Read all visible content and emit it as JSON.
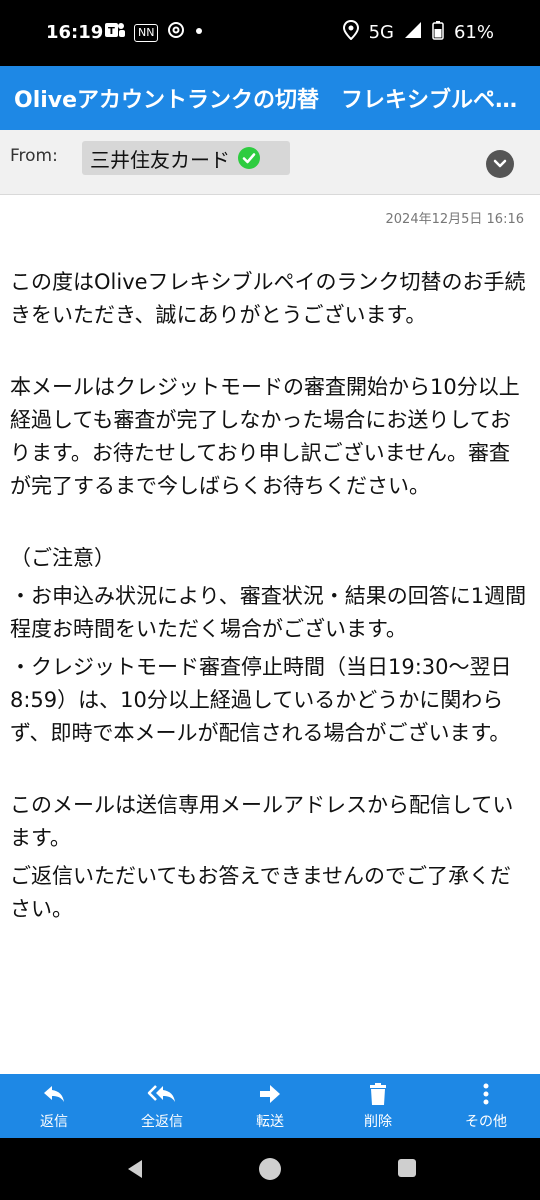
{
  "status_bar": {
    "time": "16:19",
    "app_icons": [
      "teams-icon",
      "nn-icon",
      "threads-icon",
      "dot-icon"
    ],
    "nn_label": "NN",
    "network": "5G",
    "battery": "61%"
  },
  "header": {
    "title": "Oliveアカウントランクの切替　フレキシブルペイのランク切替"
  },
  "from": {
    "label": "From:",
    "sender": "三井住友カード"
  },
  "date": "2024年12月5日 16:16",
  "body": {
    "p1": "この度はOliveフレキシブルペイのランク切替のお手続きをいただき、誠にありがとうございます。",
    "p2": "本メールはクレジットモードの審査開始から10分以上経過しても審査が完了しなかった場合にお送りしております。お待たせしており申し訳ございません。審査が完了するまで今しばらくお待ちください。",
    "notice_heading": "（ご注意）",
    "notice1": "・お申込み状況により、審査状況・結果の回答に1週間程度お時間をいただく場合がございます。",
    "notice2": "・クレジットモード審査停止時間（当日19:30〜翌日8:59）は、10分以上経過しているかどうかに関わらず、即時で本メールが配信される場合がございます。",
    "p3": "このメールは送信専用メールアドレスから配信しています。",
    "p4": "ご返信いただいてもお答えできませんのでご了承ください。"
  },
  "toolbar": {
    "reply": "返信",
    "reply_all": "全返信",
    "forward": "転送",
    "delete": "削除",
    "more": "その他"
  },
  "colors": {
    "accent": "#1e88e5",
    "verified": "#2ecc40"
  }
}
